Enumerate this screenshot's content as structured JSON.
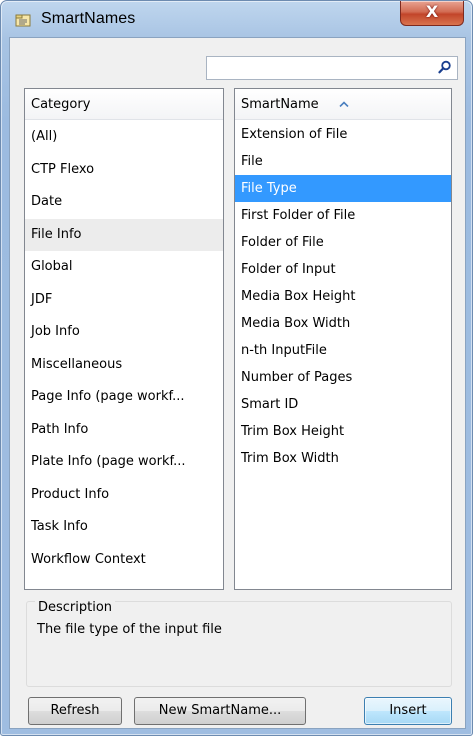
{
  "window": {
    "title": "SmartNames",
    "close_glyph": "X",
    "app_icon": "smartnames-folder-icon"
  },
  "search": {
    "value": "",
    "placeholder": "",
    "icon": "search-icon"
  },
  "category": {
    "header": "Category",
    "items": [
      "(All)",
      "CTP Flexo",
      "Date",
      "File Info",
      "Global",
      "JDF",
      "Job Info",
      "Miscellaneous",
      "Page Info (page workf...",
      "Path Info",
      "Plate Info (page workf...",
      "Product Info",
      "Task Info",
      "Workflow Context"
    ],
    "hovered": "File Info"
  },
  "smartnames": {
    "header": "SmartName",
    "sort": "ascending",
    "items": [
      "Extension of File",
      "File",
      "File Type",
      "First Folder of File",
      "Folder of File",
      "Folder of Input",
      "Media Box Height",
      "Media Box Width",
      "n-th InputFile",
      "Number of Pages",
      "Smart ID",
      "Trim Box Height",
      "Trim Box Width"
    ],
    "selected": "File Type"
  },
  "description": {
    "label": "Description",
    "text": "The file type of the input file"
  },
  "buttons": {
    "refresh": "Refresh",
    "new_smartname": "New SmartName...",
    "insert": "Insert"
  },
  "colors": {
    "selection": "#3399ff",
    "hover": "#ececec",
    "titlebar": "#a7c3e3",
    "close": "#c2452a"
  }
}
